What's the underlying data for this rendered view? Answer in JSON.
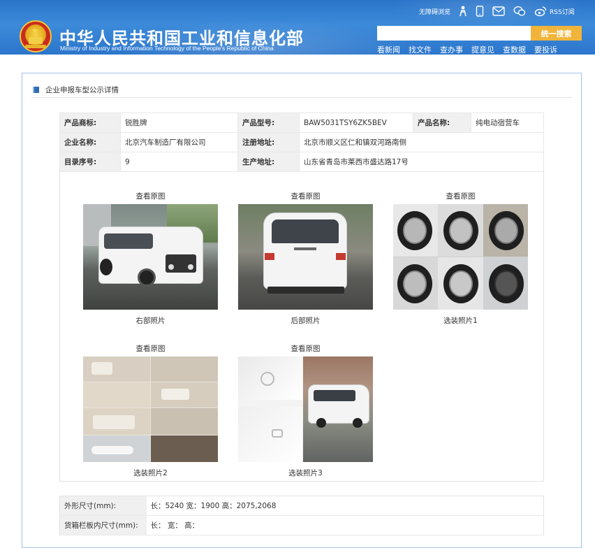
{
  "header": {
    "title": "中华人民共和国工业和信息化部",
    "subtitle": "Ministry of Industry and Information Technology of the People's Republic of China",
    "top_links": {
      "accessibility": "无障碍浏览",
      "rss": "RSS订阅"
    },
    "search": {
      "placeholder": "",
      "button": "统一搜索"
    },
    "nav": [
      "看新闻",
      "找文件",
      "查办事",
      "提意见",
      "查数据",
      "要投诉"
    ]
  },
  "panel": {
    "heading": "企业申报车型公示详情"
  },
  "info": {
    "rows": [
      {
        "k1": "产品商标:",
        "v1": "锐胜牌",
        "k2": "产品型号:",
        "v2": "BAW5031TSY6ZK5BEV",
        "k3": "产品名称:",
        "v3": "纯电动宿营车"
      },
      {
        "k1": "企业名称:",
        "v1": "北京汽车制造厂有限公司",
        "k2": "注册地址:",
        "v2": "北京市顺义区仁和镇双河路南侧"
      },
      {
        "k1": "目录序号:",
        "v1": "9",
        "k2": "生产地址:",
        "v2": "山东省青岛市莱西市盛达路17号"
      }
    ]
  },
  "photos": [
    {
      "view": "查看原图",
      "caption": "右部照片"
    },
    {
      "view": "查看原图",
      "caption": "后部照片"
    },
    {
      "view": "查看原图",
      "caption": "选装照片1"
    },
    {
      "view": "查看原图",
      "caption": "选装照片2"
    },
    {
      "view": "查看原图",
      "caption": "选装照片3"
    }
  ],
  "specs": [
    {
      "k": "外形尺寸(mm):",
      "v": "长：5240 宽：1900 高：2075,2068"
    },
    {
      "k": "货箱栏板内尺寸(mm):",
      "v": "长：  宽：  高："
    }
  ],
  "colors": {
    "header_blue": "#2a74c9",
    "search_button": "#f0b43a",
    "panel_border": "#9ec3e6"
  }
}
